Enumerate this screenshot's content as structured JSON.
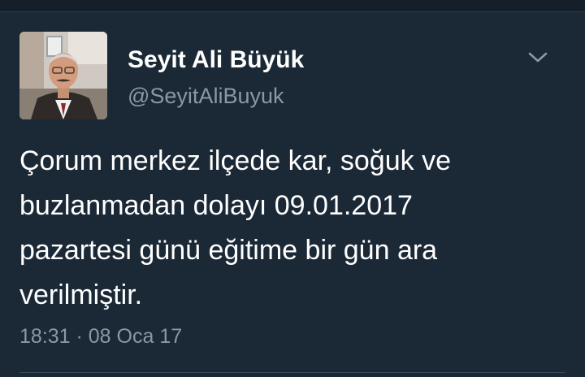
{
  "author": {
    "name": "Seyit Ali Büyük",
    "handle": "@SeyitAliBuyuk",
    "avatar_icon": "profile-photo-icon"
  },
  "tweet": {
    "lines": [
      "Çorum merkez ilçede kar, soğuk ve",
      "buzlanmadan dolayı 09.01.2017",
      "pazartesi günü eğitime bir gün ara",
      "verilmiştir."
    ],
    "timestamp": "18:31 · 08 Oca 17"
  },
  "icons": {
    "menu": "chevron-down-icon"
  },
  "colors": {
    "background": "#1b2836",
    "secondary_text": "#8899a6",
    "primary_text": "#ffffff"
  }
}
